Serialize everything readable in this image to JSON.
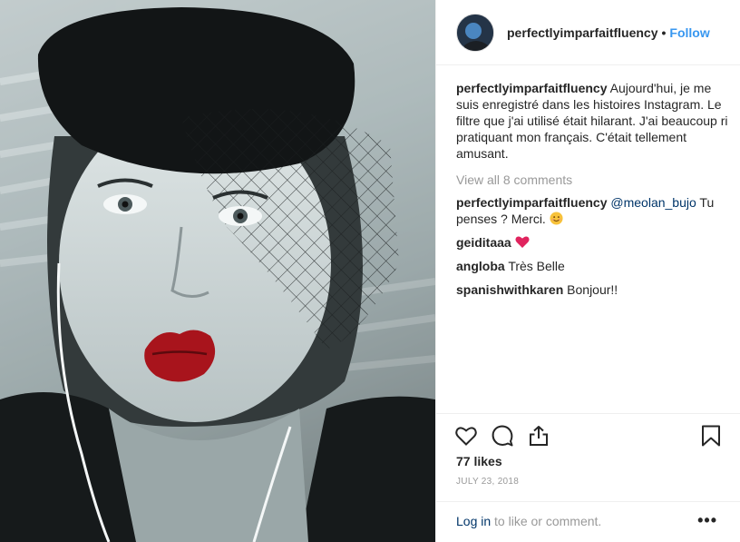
{
  "photo": {
    "description_icon": "selfie-photo"
  },
  "header": {
    "username": "perfectlyimparfaitfluency",
    "separator": "•",
    "follow_label": "Follow"
  },
  "caption": {
    "username": "perfectlyimparfaitfluency",
    "text": "Aujourd'hui, je me suis enregistré dans les histoires Instagram. Le filtre que j'ai utilisé était hilarant. J'ai beaucoup ri pratiquant mon français. C'était tellement amusant."
  },
  "view_all_label": "View all 8 comments",
  "comments": [
    {
      "username": "perfectlyimparfaitfluency",
      "mention": "@meolan_bujo",
      "text": "Tu penses ? Merci.",
      "emoji": "smiling-face-emoji"
    },
    {
      "username": "geiditaaa",
      "text": "",
      "emoji": "red-heart-emoji"
    },
    {
      "username": "angloba",
      "text": "Très Belle"
    },
    {
      "username": "spanishwithkaren",
      "text": "Bonjour!!"
    }
  ],
  "actions": {
    "icons": [
      "heart-icon",
      "comment-icon",
      "share-icon",
      "bookmark-icon"
    ],
    "likes": "77 likes",
    "date": "JULY 23, 2018"
  },
  "footer": {
    "login_link": "Log in",
    "login_suffix": " to like or comment.",
    "more": "•••"
  },
  "colors": {
    "accent": "#3897f0",
    "link_dark": "#003569",
    "muted": "#999999",
    "heart": "#e0245e"
  }
}
